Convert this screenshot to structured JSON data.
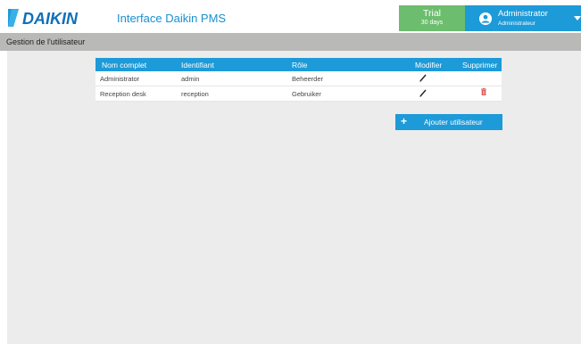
{
  "header": {
    "brand": "DAIKIN",
    "app_title": "Interface Daikin PMS",
    "trial_label": "Trial",
    "trial_days": "30 days",
    "user_name": "Administrator",
    "user_role": "Administrateur"
  },
  "subheader": {
    "title": "Gestion de l'utilisateur"
  },
  "table": {
    "columns": [
      "Nom complet",
      "Identifiant",
      "Rôle",
      "Modifier",
      "Supprimer"
    ],
    "rows": [
      {
        "full_name": "Administrator",
        "username": "admin",
        "role": "Beheerder",
        "deletable": false
      },
      {
        "full_name": "Reception desk",
        "username": "reception",
        "role": "Gebruiker",
        "deletable": true
      }
    ]
  },
  "actions": {
    "add_user_label": "Ajouter utilisateur"
  },
  "colors": {
    "accent_blue": "#1d9ad8",
    "trial_green": "#6cbd6e",
    "delete_red": "#d9534f",
    "subheader_gray": "#b9b9b7",
    "content_gray": "#ececec"
  },
  "icons": {
    "logo": "daikin-logo",
    "avatar": "user-avatar-icon",
    "dropdown": "caret-down-icon",
    "edit": "pencil-icon",
    "delete": "trash-icon",
    "add": "plus-icon"
  }
}
